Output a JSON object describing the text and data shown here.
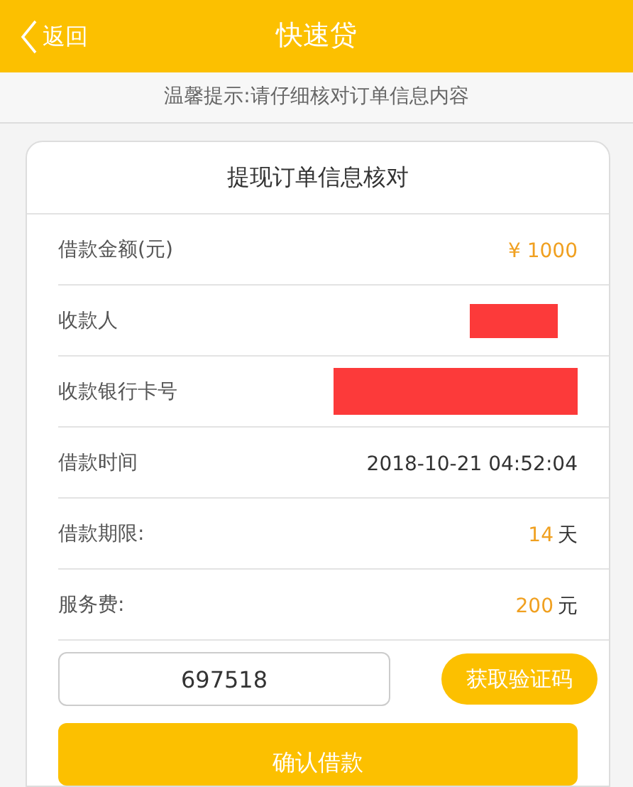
{
  "header": {
    "back": "返回",
    "title": "快速贷"
  },
  "notice": "温馨提示:请仔细核对订单信息内容",
  "card": {
    "title": "提现订单信息核对",
    "rows": [
      {
        "kind": "highlight",
        "label": "借款金额(元)",
        "value": "¥ 1000"
      },
      {
        "kind": "redacted",
        "label": "收款人"
      },
      {
        "kind": "redacted",
        "label": "收款银行卡号"
      },
      {
        "kind": "plain",
        "label": "借款时间",
        "value": "2018-10-21 04:52:04"
      },
      {
        "kind": "highlight",
        "label": "借款期限:",
        "value": "14",
        "unit": "天"
      },
      {
        "kind": "highlight",
        "label": "服务费:",
        "value": "200",
        "unit": "元"
      }
    ],
    "code": {
      "value": "697518",
      "button": "获取验证码"
    },
    "confirm": "确认借款"
  }
}
